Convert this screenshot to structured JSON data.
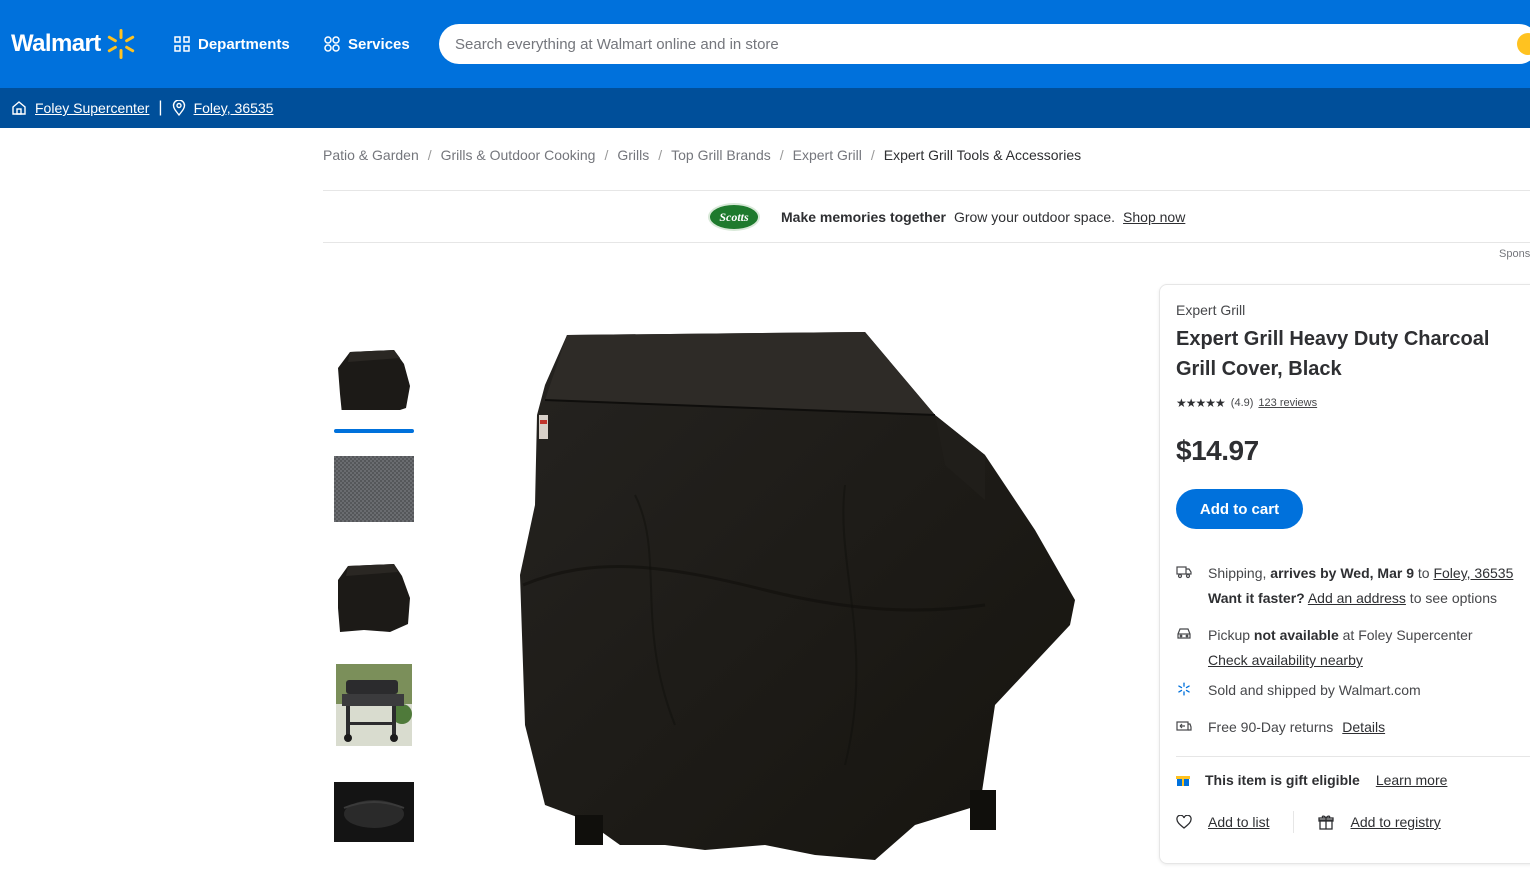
{
  "header": {
    "logo_text": "Walmart",
    "departments_label": "Departments",
    "services_label": "Services",
    "search_placeholder": "Search everything at Walmart online and in store"
  },
  "location_bar": {
    "store": "Foley Supercenter",
    "separator": "|",
    "zip": "Foley, 36535"
  },
  "breadcrumb": [
    "Patio & Garden",
    "Grills & Outdoor Cooking",
    "Grills",
    "Top Grill Brands",
    "Expert Grill",
    "Expert Grill Tools & Accessories"
  ],
  "promo": {
    "logo_text": "Scotts",
    "headline": "Make memories together",
    "text": "Grow your outdoor space.",
    "link": "Shop now",
    "sponsored": "Spons"
  },
  "product": {
    "brand": "Expert Grill",
    "title": "Expert Grill Heavy Duty Charcoal Grill Cover, Black",
    "stars": "★★★★★",
    "rating": "(4.9)",
    "reviews": "123 reviews",
    "rating_value": 4.9,
    "price": "$14.97",
    "add_to_cart": "Add to cart"
  },
  "fulfillment": {
    "shipping_prefix": "Shipping, ",
    "shipping_bold": "arrives by Wed, Mar 9",
    "shipping_to": " to ",
    "shipping_zip": "Foley, 36535",
    "faster_bold": "Want it faster?",
    "faster_link": "Add an address",
    "faster_suffix": " to see options",
    "pickup_prefix": "Pickup ",
    "pickup_bold": "not available",
    "pickup_suffix": " at Foley Supercenter",
    "pickup_link": "Check availability nearby",
    "sold_by": "Sold and shipped by Walmart.com",
    "returns": "Free 90-Day returns",
    "returns_link": "Details",
    "gift_bold": "This item is gift eligible",
    "gift_link": "Learn more",
    "add_to_list": "Add to list",
    "add_to_registry": "Add to registry"
  },
  "colors": {
    "walmart_blue": "#0071dc",
    "subbar_blue": "#004f9a",
    "spark_yellow": "#ffc220"
  }
}
